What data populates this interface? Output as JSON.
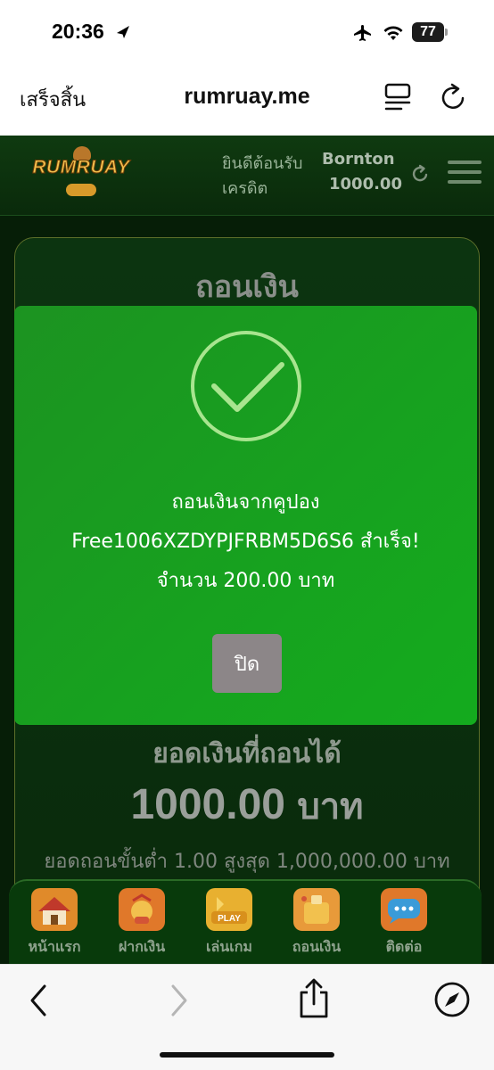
{
  "status_bar": {
    "time": "20:36",
    "battery": "77"
  },
  "browser": {
    "done_label": "เสร็จสิ้น",
    "url": "rumruay.me"
  },
  "site": {
    "logo_text": "RUMRUAY",
    "welcome_label": "ยินดีต้อนรับ",
    "username": "Bornton",
    "credit_label": "เครดิต",
    "credit_value": "1000.00"
  },
  "card": {
    "title": "ถอนเงิน",
    "balance_label": "ยอดเงินที่ถอนได้",
    "balance_amount": "1000.00",
    "balance_unit": "บาท",
    "limit_text": "ยอดถอนขั้นต่ำ 1.00 สูงสุด 1,000,000.00 บาท"
  },
  "modal": {
    "line1": "ถอนเงินจากคูปอง",
    "line2": "Free1006XZDYPJFRBM5D6S6  สำเร็จ!",
    "line3": "จำนวน 200.00 บาท",
    "close_label": "ปิด"
  },
  "bottom_nav": {
    "items": [
      {
        "label": "หน้าแรก",
        "icon": "home-icon"
      },
      {
        "label": "ฝากเงิน",
        "icon": "deposit-icon"
      },
      {
        "label": "เล่นเกม",
        "icon": "play-icon",
        "badge": "PLAY"
      },
      {
        "label": "ถอนเงิน",
        "icon": "withdraw-icon"
      },
      {
        "label": "ติดต่อ",
        "icon": "chat-icon"
      }
    ]
  },
  "colors": {
    "modal_bg": "#17a11f",
    "header_bg": "#0f3a10",
    "close_button": "#8c8688",
    "check_circle": "#a8e58f"
  }
}
